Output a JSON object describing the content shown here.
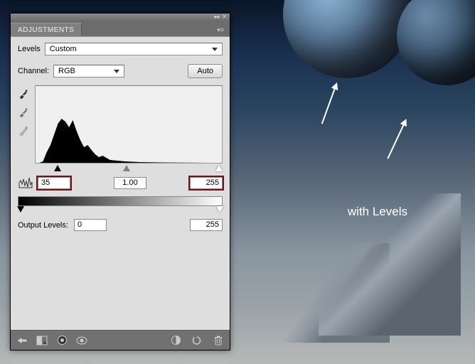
{
  "panel": {
    "tab_label": "ADJUSTMENTS",
    "levels_label": "Levels",
    "preset_value": "Custom",
    "channel_label": "Channel:",
    "channel_value": "RGB",
    "auto_label": "Auto",
    "input_shadow": "35",
    "input_mid": "1.00",
    "input_highlight": "255",
    "output_label": "Output Levels:",
    "output_shadow": "0",
    "output_highlight": "255"
  },
  "overlay": {
    "text": "with Levels"
  },
  "icons": {
    "collapse": "◂◂",
    "close": "✕",
    "menu": "▾≡",
    "back": "⇦",
    "new_adj": "◧",
    "view": "◉",
    "toggle": "◐",
    "clip": "◩",
    "reset": "⟳",
    "trash": "🗑"
  }
}
